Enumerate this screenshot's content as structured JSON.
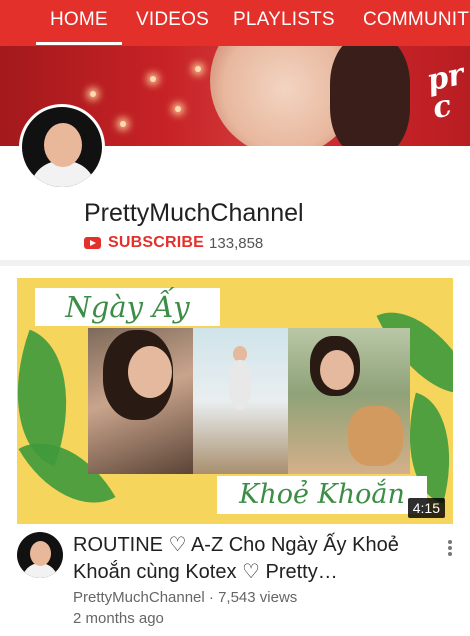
{
  "tabs": [
    {
      "label": "HOME",
      "active": true
    },
    {
      "label": "VIDEOS"
    },
    {
      "label": "PLAYLISTS"
    },
    {
      "label": "COMMUNITY"
    }
  ],
  "colors": {
    "accent": "#e4302a",
    "thumbnail_bg": "#f6d55c",
    "thumbnail_text": "#3c8d46"
  },
  "channel": {
    "name": "PrettyMuchChannel",
    "subscribe_label": "SUBSCRIBE",
    "subscriber_count": "133,858"
  },
  "video": {
    "thumbnail_line1": "Ngày Ấy",
    "thumbnail_line2": "Khoẻ Khoắn",
    "duration": "4:15",
    "title": "ROUTINE ♡ A-Z Cho Ngày Ấy Khoẻ Khoắn cùng Kotex ♡ Pretty…",
    "meta": "PrettyMuchChannel · 7,543 views",
    "age": "2 months ago"
  },
  "icons": {
    "subscribe": "youtube-play-icon",
    "more": "more-vertical-icon"
  }
}
